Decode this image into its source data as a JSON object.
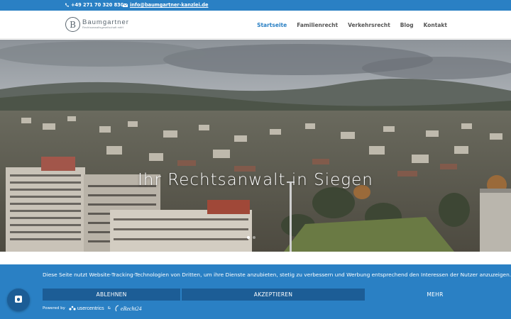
{
  "topbar": {
    "phone": "+49 271 70 320 830",
    "email": "info@baumgartner-kanzlei.de"
  },
  "logo": {
    "mark": "B",
    "name": "Baumgartner",
    "subtitle": "Rechtsanwaltsgesellschaft mbH"
  },
  "nav": {
    "items": [
      {
        "label": "Startseite",
        "active": true
      },
      {
        "label": "Familienrecht",
        "active": false
      },
      {
        "label": "Verkehrsrecht",
        "active": false
      },
      {
        "label": "Blog",
        "active": false
      },
      {
        "label": "Kontakt",
        "active": false
      }
    ]
  },
  "hero": {
    "title": "Ihr Rechtsanwalt in Siegen",
    "slides": 2,
    "active_slide": 1
  },
  "cookie": {
    "text": "Diese Seite nutzt Website-Tracking-Technologien von Dritten, um ihre Dienste anzubieten, stetig zu verbessern und Werbung entsprechend den Interessen der Nutzer anzuzeigen.",
    "reject_label": "ABLEHNEN",
    "accept_label": "AKZEPTIEREN",
    "more_label": "MEHR",
    "powered_by": "Powered by",
    "brand1": "usercentrics",
    "amp": "&",
    "brand2": "eRecht24"
  },
  "colors": {
    "primary": "#2a80c4",
    "button": "#1c5d96",
    "nav_text": "#555555"
  },
  "icons": {
    "phone": "phone-icon",
    "mail": "mail-icon",
    "privacy": "privacy-shield-icon"
  }
}
